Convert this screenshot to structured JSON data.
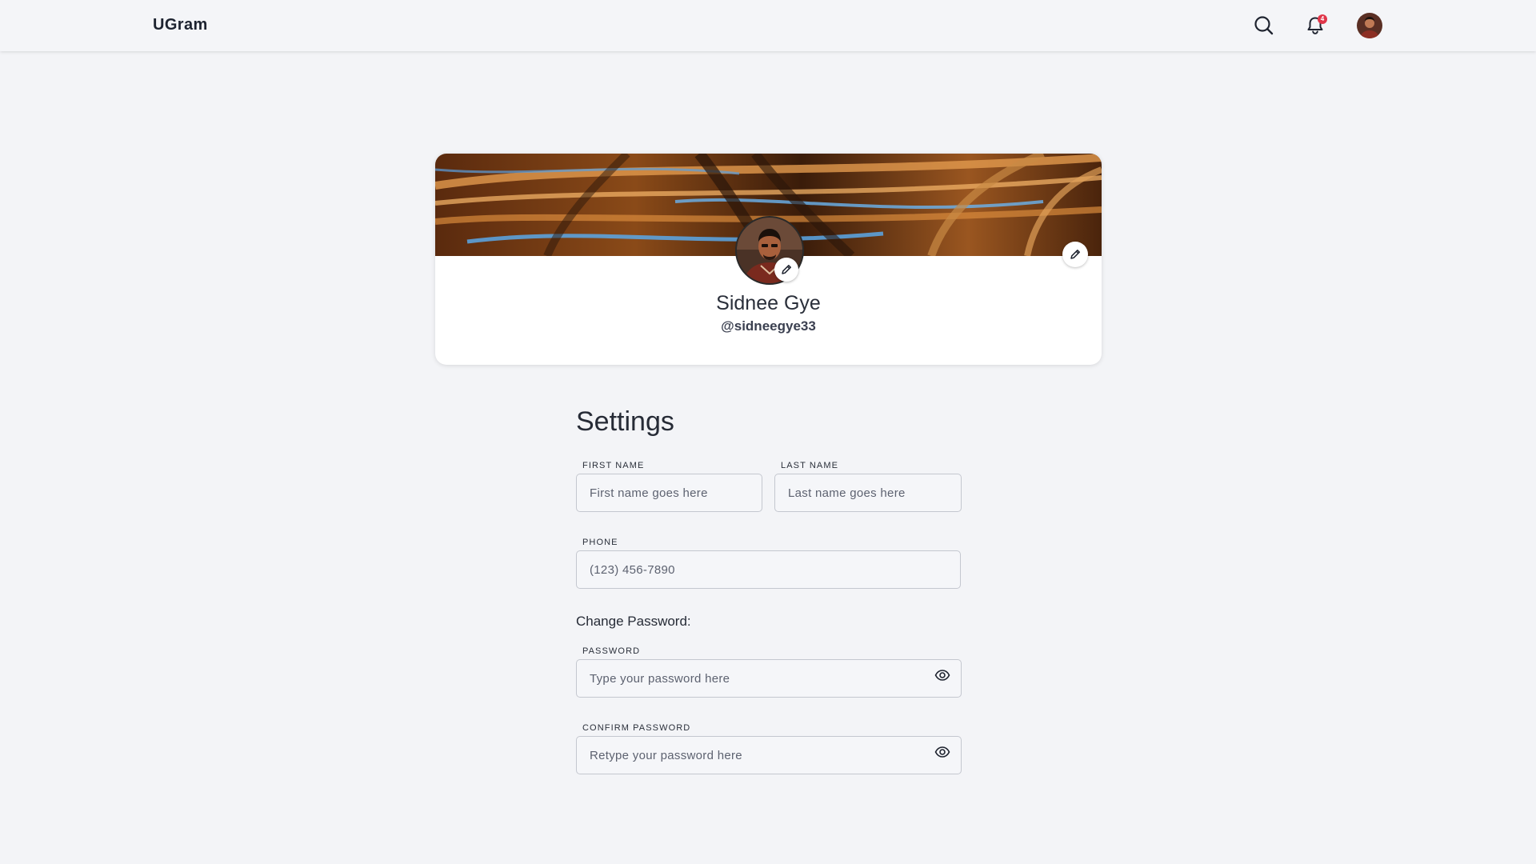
{
  "header": {
    "brand": "UGram",
    "notification_count": "4"
  },
  "profile": {
    "name": "Sidnee Gye",
    "handle": "@sidneegye33"
  },
  "settings": {
    "title": "Settings",
    "first_name": {
      "label": "FIRST NAME",
      "placeholder": "First name goes here",
      "value": ""
    },
    "last_name": {
      "label": "LAST NAME",
      "placeholder": "Last name goes here",
      "value": ""
    },
    "phone": {
      "label": "PHONE",
      "placeholder": "(123) 456-7890",
      "value": ""
    },
    "change_password_heading": "Change Password:",
    "password": {
      "label": "PASSWORD",
      "placeholder": "Type your password here",
      "value": ""
    },
    "confirm_password": {
      "label": "CONFIRM PASSWORD",
      "placeholder": "Retype your password here",
      "value": ""
    }
  },
  "icons": {
    "search": "search-icon",
    "bell": "bell-icon",
    "pencil": "pencil-icon",
    "eye": "eye-icon"
  },
  "colors": {
    "background": "#f3f4f7",
    "badge": "#e0364a",
    "card": "#ffffff",
    "input_border": "#c4c7cf"
  }
}
